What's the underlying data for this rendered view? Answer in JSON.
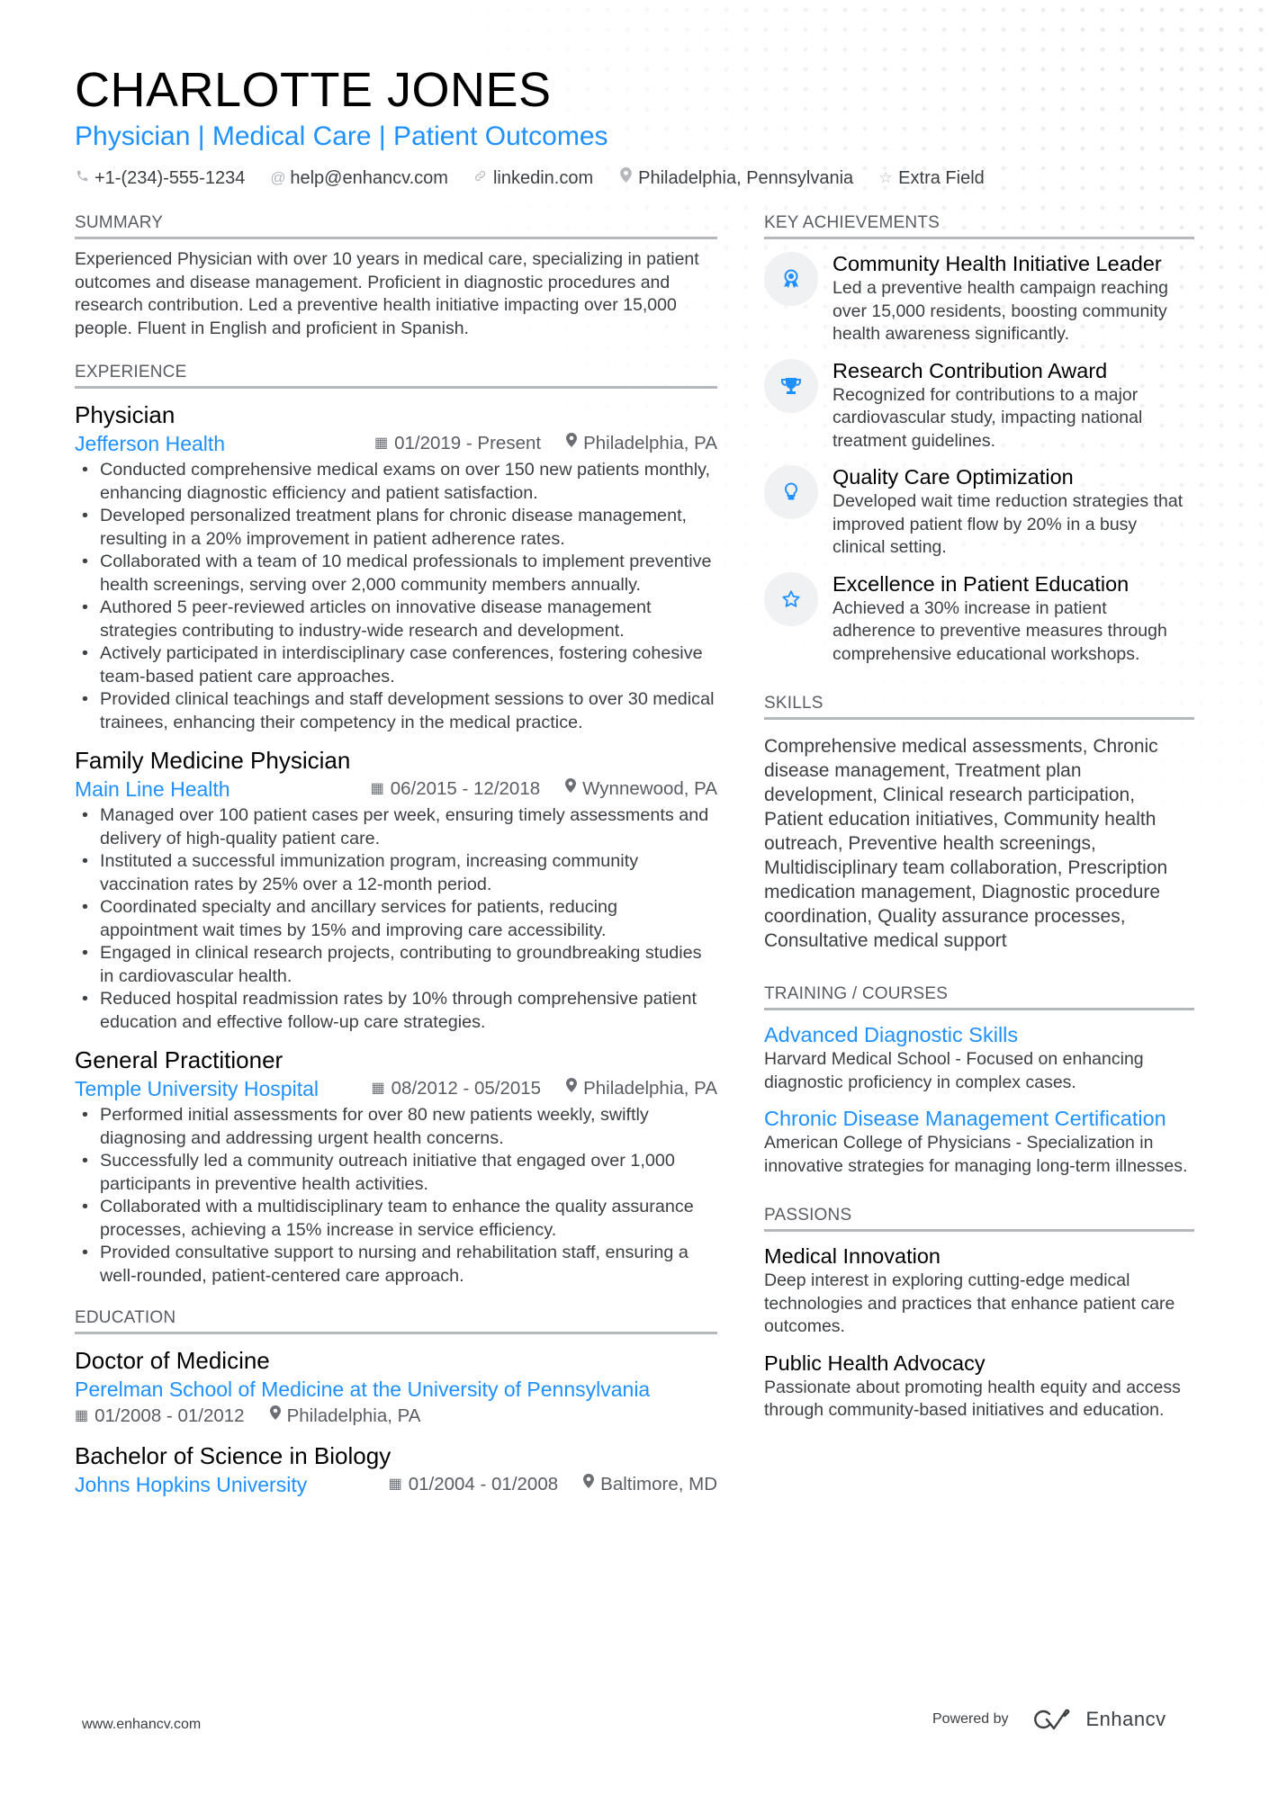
{
  "header": {
    "name": "CHARLOTTE JONES",
    "title": "Physician | Medical Care | Patient Outcomes",
    "contacts": [
      {
        "icon": "phone-icon",
        "glyph": "✆",
        "text": "+1-(234)-555-1234"
      },
      {
        "icon": "at-icon",
        "glyph": "@",
        "text": "help@enhancv.com"
      },
      {
        "icon": "link-icon",
        "glyph": "∞",
        "text": "linkedin.com"
      },
      {
        "icon": "location-icon",
        "glyph": "●",
        "text": "Philadelphia, Pennsylvania"
      },
      {
        "icon": "star-icon",
        "glyph": "☆",
        "text": "Extra Field"
      }
    ]
  },
  "summary": {
    "heading": "SUMMARY",
    "text": "Experienced Physician with over 10 years in medical care, specializing in patient outcomes and disease management. Proficient in diagnostic procedures and research contribution. Led a preventive health initiative impacting over 15,000 people. Fluent in English and proficient in Spanish."
  },
  "experience": {
    "heading": "EXPERIENCE",
    "jobs": [
      {
        "title": "Physician",
        "org": "Jefferson Health",
        "dates": "01/2019 - Present",
        "location": "Philadelphia, PA",
        "bullets": [
          "Conducted comprehensive medical exams on over 150 new patients monthly, enhancing diagnostic efficiency and patient satisfaction.",
          "Developed personalized treatment plans for chronic disease management, resulting in a 20% improvement in patient adherence rates.",
          "Collaborated with a team of 10 medical professionals to implement preventive health screenings, serving over 2,000 community members annually.",
          "Authored 5 peer-reviewed articles on innovative disease management strategies contributing to industry-wide research and development.",
          "Actively participated in interdisciplinary case conferences, fostering cohesive team-based patient care approaches.",
          "Provided clinical teachings and staff development sessions to over 30 medical trainees, enhancing their competency in the medical practice."
        ]
      },
      {
        "title": "Family Medicine Physician",
        "org": "Main Line Health",
        "dates": "06/2015 - 12/2018",
        "location": "Wynnewood, PA",
        "bullets": [
          "Managed over 100 patient cases per week, ensuring timely assessments and delivery of high-quality patient care.",
          "Instituted a successful immunization program, increasing community vaccination rates by 25% over a 12-month period.",
          "Coordinated specialty and ancillary services for patients, reducing appointment wait times by 15% and improving care accessibility.",
          "Engaged in clinical research projects, contributing to groundbreaking studies in cardiovascular health.",
          "Reduced hospital readmission rates by 10% through comprehensive patient education and effective follow-up care strategies."
        ]
      },
      {
        "title": "General Practitioner",
        "org": "Temple University Hospital",
        "dates": "08/2012 - 05/2015",
        "location": "Philadelphia, PA",
        "bullets": [
          "Performed initial assessments for over 80 new patients weekly, swiftly diagnosing and addressing urgent health concerns.",
          "Successfully led a community outreach initiative that engaged over 1,000 participants in preventive health activities.",
          "Collaborated with a multidisciplinary team to enhance the quality assurance processes, achieving a 15% increase in service efficiency.",
          "Provided consultative support to nursing and rehabilitation staff, ensuring a well-rounded, patient-centered care approach."
        ]
      }
    ]
  },
  "education": {
    "heading": "EDUCATION",
    "items": [
      {
        "degree": "Doctor of Medicine",
        "school": "Perelman School of Medicine at the University of Pennsylvania",
        "dates": "01/2008 - 01/2012",
        "location": "Philadelphia, PA"
      },
      {
        "degree": "Bachelor of Science in Biology",
        "school": "Johns Hopkins University",
        "dates": "01/2004 - 01/2008",
        "location": "Baltimore, MD"
      }
    ]
  },
  "achievements": {
    "heading": "KEY ACHIEVEMENTS",
    "items": [
      {
        "icon": "award-ribbon-icon",
        "title": "Community Health Initiative Leader",
        "desc": "Led a preventive health campaign reaching over 15,000 residents, boosting community health awareness significantly."
      },
      {
        "icon": "trophy-icon",
        "title": "Research Contribution Award",
        "desc": "Recognized for contributions to a major cardiovascular study, impacting national treatment guidelines."
      },
      {
        "icon": "lightbulb-icon",
        "title": "Quality Care Optimization",
        "desc": "Developed wait time reduction strategies that improved patient flow by 20% in a busy clinical setting."
      },
      {
        "icon": "star-icon",
        "title": "Excellence in Patient Education",
        "desc": "Achieved a 30% increase in patient adherence to preventive measures through comprehensive educational workshops."
      }
    ]
  },
  "skills": {
    "heading": "SKILLS",
    "text": "Comprehensive medical assessments, Chronic disease management, Treatment plan development, Clinical research participation, Patient education initiatives, Community health outreach, Preventive health screenings, Multidisciplinary team collaboration, Prescription medication management, Diagnostic procedure coordination, Quality assurance processes, Consultative medical support"
  },
  "training": {
    "heading": "TRAINING / COURSES",
    "items": [
      {
        "title": "Advanced Diagnostic Skills",
        "desc": "Harvard Medical School - Focused on enhancing diagnostic proficiency in complex cases."
      },
      {
        "title": "Chronic Disease Management Certification",
        "desc": "American College of Physicians - Specialization in innovative strategies for managing long-term illnesses."
      }
    ]
  },
  "passions": {
    "heading": "PASSIONS",
    "items": [
      {
        "title": "Medical Innovation",
        "desc": "Deep interest in exploring cutting-edge medical technologies and practices that enhance patient care outcomes."
      },
      {
        "title": "Public Health Advocacy",
        "desc": "Passionate about promoting health equity and access through community-based initiatives and education."
      }
    ]
  },
  "footer": {
    "website": "www.enhancv.com",
    "powered_by": "Powered by",
    "brand": "Enhancv"
  },
  "colors": {
    "accent": "#1e90ff",
    "text": "#3c4043",
    "heading": "#000000",
    "rule": "#b4b8bd"
  }
}
